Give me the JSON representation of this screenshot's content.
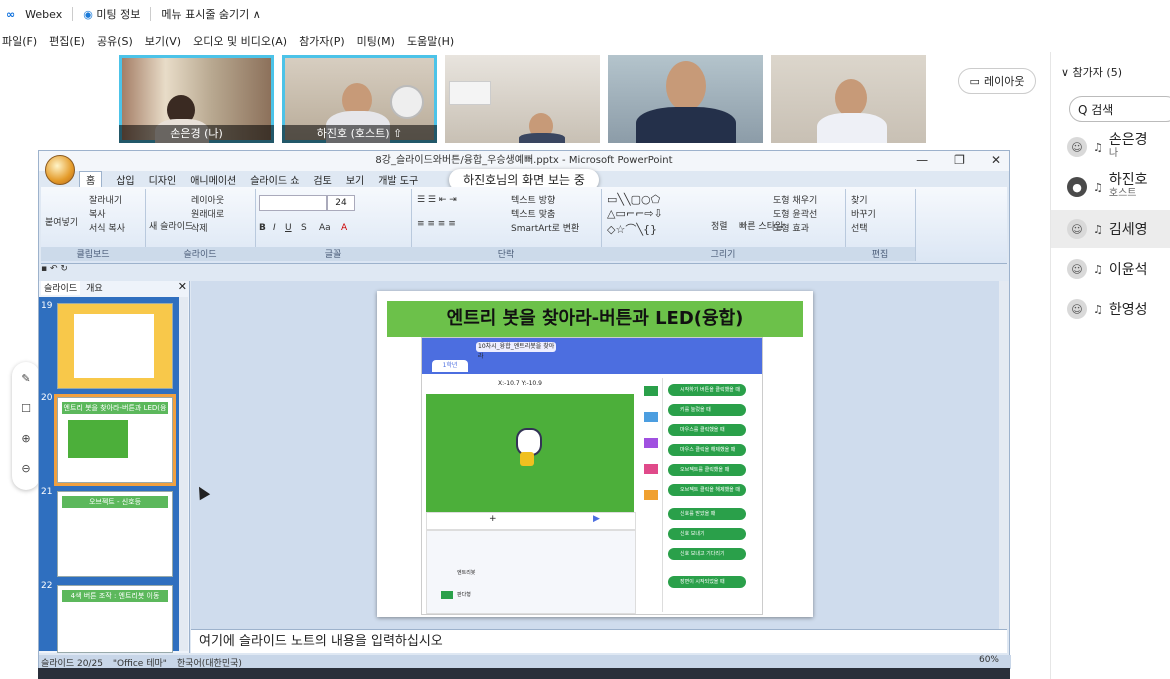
{
  "topbar": {
    "app": "Webex",
    "meeting_info": "미팅 정보",
    "hide_menu": "메뉴 표시줄 숨기기 ∧"
  },
  "menu": [
    "파일(F)",
    "편집(E)",
    "공유(S)",
    "보기(V)",
    "오디오 및 비디오(A)",
    "참가자(P)",
    "미팅(M)",
    "도움말(H)"
  ],
  "video_tiles": [
    {
      "name": "손은경 (나)"
    },
    {
      "name": "하진호 (호스트)"
    },
    {
      "name": ""
    },
    {
      "name": ""
    },
    {
      "name": ""
    }
  ],
  "layout_button": "레이아웃",
  "participants": {
    "header": "∨ 참가자 (5)",
    "search_placeholder": "Q 검색",
    "list": [
      {
        "name": "손은경",
        "role": "나"
      },
      {
        "name": "하진호",
        "role": "호스트"
      },
      {
        "name": "김세영",
        "role": ""
      },
      {
        "name": "이윤석",
        "role": ""
      },
      {
        "name": "한영성",
        "role": ""
      }
    ]
  },
  "ppt": {
    "window_title": "8강_슬라이드와버튼/융합_우승생예뻐.pptx - Microsoft PowerPoint",
    "sharing_banner": "하진호님의 화면 보는 중",
    "tabs": [
      "홈",
      "삽입",
      "디자인",
      "애니메이션",
      "슬라이드 쇼",
      "검토",
      "보기",
      "개발 도구"
    ],
    "ribbon_groups": [
      "클립보드",
      "슬라이드",
      "글꼴",
      "단락",
      "그리기",
      "편집"
    ],
    "clipboard_items": [
      "붙여넣기",
      "잘라내기",
      "복사",
      "서식 복사"
    ],
    "slide_items": [
      "새 슬라이드",
      "레이아웃",
      "원래대로",
      "삭제"
    ],
    "font_size": "24",
    "paragraph_items": [
      "텍스트 방향",
      "텍스트 맞춤",
      "SmartArt로 변환"
    ],
    "drawing_items": [
      "정렬",
      "빠른 스타일",
      "도형 채우기",
      "도형 윤곽선",
      "도형 효과"
    ],
    "editing_items": [
      "찾기",
      "바꾸기",
      "선택"
    ],
    "slide_pane_tabs": [
      "슬라이드",
      "개요"
    ],
    "thumbnails": [
      {
        "num": "19",
        "title": ""
      },
      {
        "num": "20",
        "title": "엔트리 봇을 찾아라-버튼과 LED(융합)"
      },
      {
        "num": "21",
        "title": "오브젝트 - 신호등"
      },
      {
        "num": "22",
        "title": "4색 버튼 조작 : 엔트리봇 이동"
      }
    ],
    "slide_title": "엔트리 봇을 찾아라-버튼과 LED(융합)",
    "entry_project_name": "10차시_융합_엔트리봇을 찾아라",
    "entry_tab": "1학년",
    "entry_coords": "X:-10.7 Y:-10.9",
    "entry_blocks": [
      "시작하기 버튼을 클릭했을 때",
      "키를 눌렀을 때",
      "마우스를 클릭했을 때",
      "마우스 클릭을 해제했을 때",
      "오브젝트를 클릭했을 때",
      "오브젝트 클릭을 해제했을 때",
      "신호를 받았을 때",
      "신호 보내기",
      "신호 보내고 기다리기",
      "장면이 시작되었을 때"
    ],
    "entry_objects": [
      "엔트리봇",
      "판다형"
    ],
    "notes_placeholder": "여기에 슬라이드 노트의 내용을 입력하십시오",
    "status": {
      "slide": "슬라이드 20/25",
      "theme": "\"Office 테마\"",
      "language": "한국어(대한민국)",
      "zoom": "60%"
    }
  },
  "colors": {
    "tile_selected": "#4cc3e8",
    "slide_title_bg": "#6cc14a",
    "entry_stage": "#4caf3a",
    "entry_header": "#4c6ee0"
  }
}
